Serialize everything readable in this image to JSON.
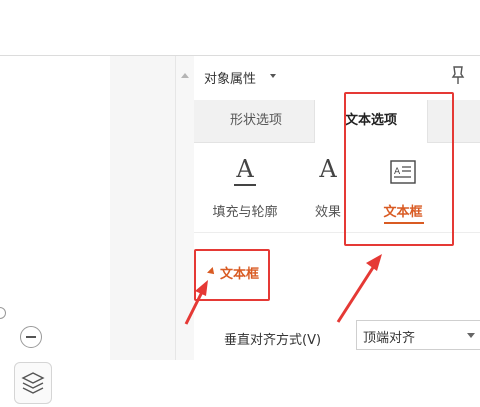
{
  "panel": {
    "title": "对象属性",
    "tabs": [
      {
        "label": "形状选项",
        "active": false
      },
      {
        "label": "文本选项",
        "active": true
      }
    ],
    "subtabs": [
      {
        "label": "填充与轮廓",
        "icon": "text-fill-icon",
        "active": false
      },
      {
        "label": "效果",
        "icon": "text-effect-icon",
        "active": false
      },
      {
        "label": "文本框",
        "icon": "text-box-icon",
        "active": true
      }
    ],
    "section": {
      "label": "文本框"
    },
    "field": {
      "label": "垂直对齐方式(V)",
      "value": "顶端对齐"
    }
  },
  "colors": {
    "accent": "#d95b23",
    "highlight": "#e53935"
  }
}
